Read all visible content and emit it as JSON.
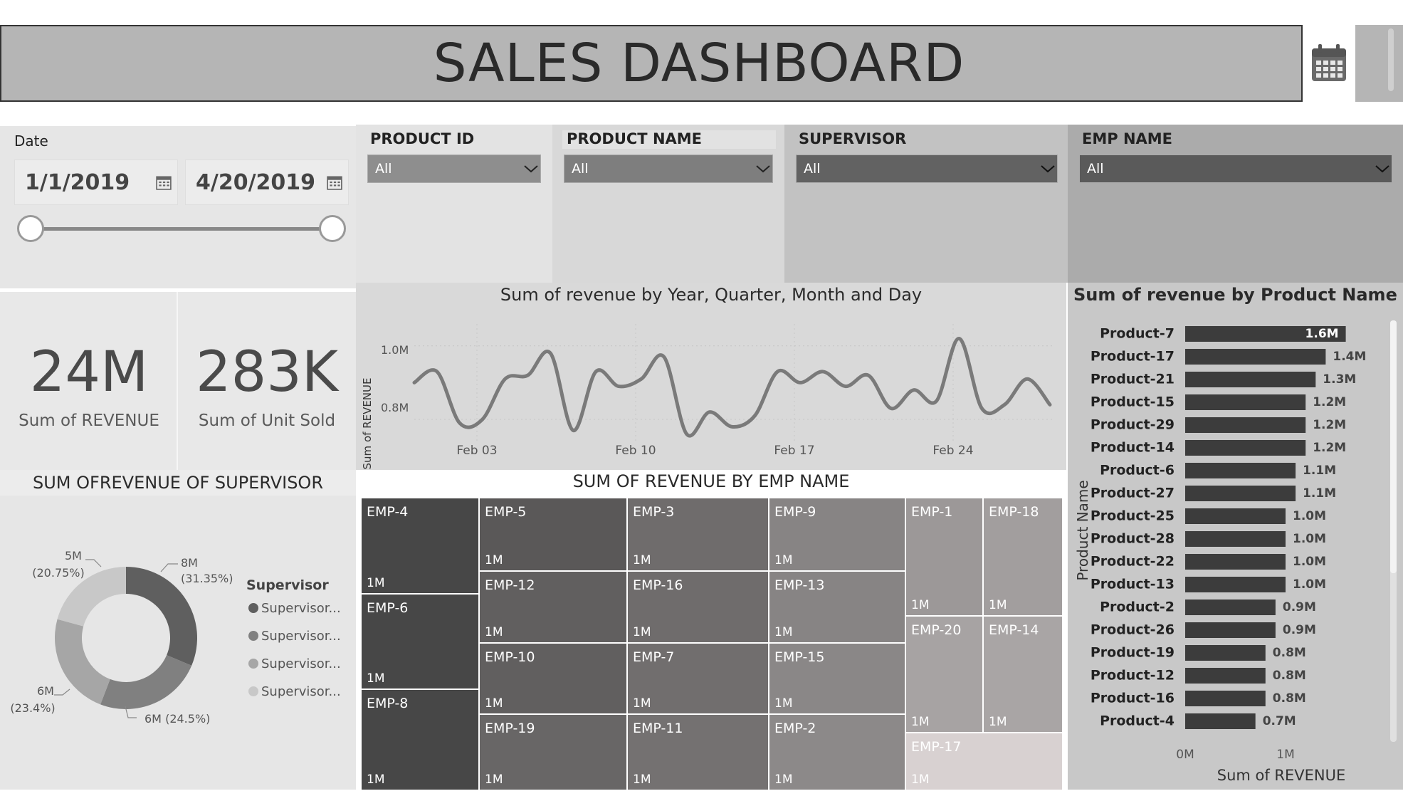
{
  "header": {
    "title": "SALES DASHBOARD",
    "calendar_icon": "calendar-icon"
  },
  "date_slicer": {
    "label": "Date",
    "start": "1/1/2019",
    "end": "4/20/2019"
  },
  "kpis": [
    {
      "value": "24M",
      "caption": "Sum of REVENUE"
    },
    {
      "value": "283K",
      "caption": "Sum of Unit Sold"
    }
  ],
  "filters": [
    {
      "label": "PRODUCT ID",
      "value": "All",
      "bg": "#e3e3e3",
      "dd_bg": "#8e8e8e"
    },
    {
      "label": "PRODUCT NAME",
      "value": "All",
      "bg": "#d8d8d8",
      "dd_bg": "#7e7e7e"
    },
    {
      "label": "SUPERVISOR",
      "value": "All",
      "bg": "#c2c2c2",
      "dd_bg": "#626262"
    },
    {
      "label": "EMP NAME",
      "value": "All",
      "bg": "#ababab",
      "dd_bg": "#5a5a5a"
    }
  ],
  "line_chart": {
    "title": "Sum of revenue by Year, Quarter, Month and Day",
    "ylabel": "Sum of REVENUE",
    "yticks": [
      "1.0M",
      "0.8M"
    ],
    "xticks": [
      "Feb 03",
      "Feb 10",
      "Feb 17",
      "Feb 24"
    ]
  },
  "donut": {
    "title": "SUM OFREVENUE OF SUPERVISOR",
    "legend_title": "Supervisor",
    "legend": [
      "Supervisor...",
      "Supervisor...",
      "Supervisor...",
      "Supervisor..."
    ],
    "labels": [
      {
        "line1": "8M",
        "line2": "(31.35%)"
      },
      {
        "line1": "6M (24.5%)",
        "line2": ""
      },
      {
        "line1": "6M",
        "line2": "(23.4%)"
      },
      {
        "line1": "5M",
        "line2": "(20.75%)"
      }
    ]
  },
  "treemap": {
    "title": "SUM OF REVENUE BY EMP NAME",
    "cells": [
      {
        "name": "EMP-4",
        "value": "1M"
      },
      {
        "name": "EMP-6",
        "value": "1M"
      },
      {
        "name": "EMP-8",
        "value": "1M"
      },
      {
        "name": "EMP-5",
        "value": "1M"
      },
      {
        "name": "EMP-12",
        "value": "1M"
      },
      {
        "name": "EMP-10",
        "value": "1M"
      },
      {
        "name": "EMP-19",
        "value": "1M"
      },
      {
        "name": "EMP-3",
        "value": "1M"
      },
      {
        "name": "EMP-16",
        "value": "1M"
      },
      {
        "name": "EMP-7",
        "value": "1M"
      },
      {
        "name": "EMP-11",
        "value": "1M"
      },
      {
        "name": "EMP-9",
        "value": "1M"
      },
      {
        "name": "EMP-13",
        "value": "1M"
      },
      {
        "name": "EMP-15",
        "value": "1M"
      },
      {
        "name": "EMP-2",
        "value": "1M"
      },
      {
        "name": "EMP-1",
        "value": "1M"
      },
      {
        "name": "EMP-18",
        "value": "1M"
      },
      {
        "name": "EMP-20",
        "value": "1M"
      },
      {
        "name": "EMP-14",
        "value": "1M"
      },
      {
        "name": "EMP-17",
        "value": "1M"
      }
    ]
  },
  "bar_chart": {
    "title": "Sum of revenue by Product Name",
    "ylabel": "Product Name",
    "xlabel": "Sum of REVENUE",
    "xticks": [
      "0M",
      "1M"
    ]
  },
  "chart_data": [
    {
      "type": "line",
      "title": "Sum of revenue by Year, Quarter, Month and Day",
      "xlabel": "",
      "ylabel": "Sum of REVENUE",
      "x": [
        "Jan 31",
        "Feb 01",
        "Feb 02",
        "Feb 03",
        "Feb 04",
        "Feb 05",
        "Feb 06",
        "Feb 07",
        "Feb 08",
        "Feb 09",
        "Feb 10",
        "Feb 11",
        "Feb 12",
        "Feb 13",
        "Feb 14",
        "Feb 15",
        "Feb 16",
        "Feb 17",
        "Feb 18",
        "Feb 19",
        "Feb 20",
        "Feb 21",
        "Feb 22",
        "Feb 23",
        "Feb 24",
        "Feb 25",
        "Feb 26",
        "Feb 27",
        "Feb 28"
      ],
      "values": [
        0.9,
        0.93,
        0.79,
        0.8,
        0.91,
        0.92,
        0.98,
        0.77,
        0.93,
        0.89,
        0.91,
        0.97,
        0.76,
        0.82,
        0.78,
        0.81,
        0.93,
        0.9,
        0.93,
        0.89,
        0.92,
        0.83,
        0.88,
        0.85,
        1.02,
        0.83,
        0.84,
        0.91,
        0.84
      ],
      "ylim": [
        0.74,
        1.05
      ],
      "yticks": [
        0.8,
        1.0
      ],
      "unit": "M"
    },
    {
      "type": "bar",
      "orientation": "horizontal",
      "title": "Sum of revenue by Product Name",
      "xlabel": "Sum of REVENUE",
      "ylabel": "Product Name",
      "categories": [
        "Product-7",
        "Product-17",
        "Product-21",
        "Product-15",
        "Product-29",
        "Product-14",
        "Product-6",
        "Product-27",
        "Product-25",
        "Product-28",
        "Product-22",
        "Product-13",
        "Product-2",
        "Product-26",
        "Product-19",
        "Product-12",
        "Product-16",
        "Product-4"
      ],
      "values": [
        1.6,
        1.4,
        1.3,
        1.2,
        1.2,
        1.2,
        1.1,
        1.1,
        1.0,
        1.0,
        1.0,
        1.0,
        0.9,
        0.9,
        0.8,
        0.8,
        0.8,
        0.7
      ],
      "data_labels": [
        "1.6M",
        "1.4M",
        "1.3M",
        "1.2M",
        "1.2M",
        "1.2M",
        "1.1M",
        "1.1M",
        "1.0M",
        "1.0M",
        "1.0M",
        "1.0M",
        "0.9M",
        "0.9M",
        "0.8M",
        "0.8M",
        "0.8M",
        "0.7M"
      ],
      "xlim": [
        0,
        2.0
      ]
    },
    {
      "type": "pie",
      "title": "SUM OFREVENUE OF SUPERVISOR",
      "categories": [
        "Supervisor...",
        "Supervisor...",
        "Supervisor...",
        "Supervisor..."
      ],
      "values": [
        8,
        6,
        6,
        5
      ],
      "percent": [
        31.35,
        24.5,
        23.4,
        20.75
      ],
      "colors": [
        "#5f5f5f",
        "#808080",
        "#a6a6a6",
        "#c8c8c8"
      ]
    }
  ]
}
